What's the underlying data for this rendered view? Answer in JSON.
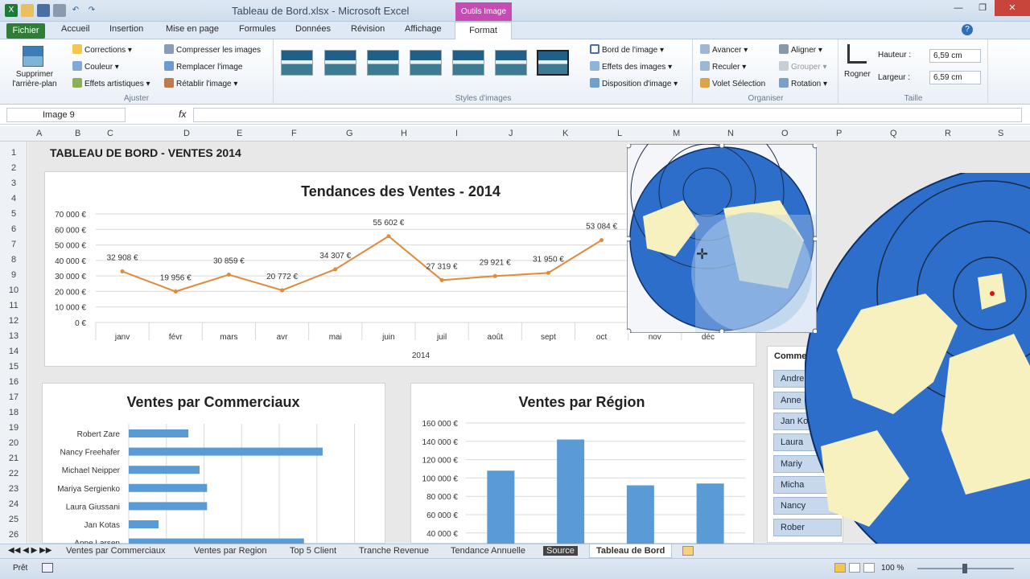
{
  "window": {
    "title": "Tableau de Bord.xlsx - Microsoft Excel",
    "context_tab": "Outils Image"
  },
  "ribbon_tabs": [
    "Fichier",
    "Accueil",
    "Insertion",
    "Mise en page",
    "Formules",
    "Données",
    "Révision",
    "Affichage",
    "Format"
  ],
  "ribbon": {
    "remove_bg": "Supprimer l'arrière-plan",
    "adjust": {
      "label": "Ajuster",
      "corrections": "Corrections",
      "couleur": "Couleur",
      "effets": "Effets artistiques",
      "compresser": "Compresser les images",
      "remplacer": "Remplacer l'image",
      "retablir": "Rétablir l'image"
    },
    "styles": {
      "label": "Styles d'images",
      "bord": "Bord de l'image",
      "effets": "Effets des images",
      "disposition": "Disposition d'image"
    },
    "organiser": {
      "label": "Organiser",
      "avancer": "Avancer",
      "reculer": "Reculer",
      "volet": "Volet Sélection",
      "aligner": "Aligner",
      "grouper": "Grouper",
      "rotation": "Rotation"
    },
    "taille": {
      "label": "Taille",
      "rogner": "Rogner",
      "hauteur_label": "Hauteur :",
      "hauteur": "6,59 cm",
      "largeur_label": "Largeur :",
      "largeur": "6,59 cm"
    }
  },
  "formula_bar": {
    "name_box": "Image 9",
    "fx": "fx",
    "formula": ""
  },
  "columns": [
    "A",
    "B",
    "C",
    "D",
    "E",
    "F",
    "G",
    "H",
    "I",
    "J",
    "K",
    "L",
    "M",
    "N",
    "O",
    "P",
    "Q",
    "R",
    "S"
  ],
  "rows": [
    "1",
    "2",
    "3",
    "4",
    "5",
    "6",
    "7",
    "8",
    "9",
    "10",
    "11",
    "12",
    "13",
    "14",
    "15",
    "16",
    "17",
    "18",
    "19",
    "20",
    "21",
    "22",
    "23",
    "24",
    "25",
    "26"
  ],
  "dashboard_title": "TABLEAU DE BORD - VENTES 2014",
  "chart_data": [
    {
      "type": "line",
      "title": "Tendances des Ventes - 2014",
      "xlabel": "2014",
      "categories": [
        "janv",
        "févr",
        "mars",
        "avr",
        "mai",
        "juin",
        "juil",
        "août",
        "sept",
        "oct",
        "nov",
        "déc"
      ],
      "values": [
        32908,
        19956,
        30859,
        20772,
        34307,
        55602,
        27319,
        29921,
        31950,
        53084,
        null,
        null
      ],
      "labels": [
        "32 908 €",
        "19 956 €",
        "30 859 €",
        "20 772 €",
        "34 307 €",
        "55 602 €",
        "27 319 €",
        "29 921 €",
        "31 950 €",
        "53 084 €"
      ],
      "yticks": [
        "0 €",
        "10 000 €",
        "20 000 €",
        "30 000 €",
        "40 000 €",
        "50 000 €",
        "60 000 €",
        "70 000 €"
      ],
      "ylim": [
        0,
        70000
      ],
      "color": "#e08a3c"
    },
    {
      "type": "bar",
      "title": "Ventes par Commerciaux",
      "categories": [
        "Robert Zare",
        "Nancy Freehafer",
        "Michael Neipper",
        "Mariya Sergienko",
        "Laura Giussani",
        "Jan Kotas",
        "Anne Larsen"
      ],
      "values": [
        16,
        52,
        19,
        21,
        21,
        8,
        47
      ],
      "color": "#5b9bd5"
    },
    {
      "type": "bar",
      "title": "Ventes par Région",
      "yticks": [
        "40 000 €",
        "60 000 €",
        "80 000 €",
        "100 000 €",
        "120 000 €",
        "140 000 €",
        "160 000 €"
      ],
      "values": [
        108000,
        142000,
        92000,
        94000
      ],
      "ylim": [
        40000,
        160000
      ],
      "color": "#5b9bd5"
    }
  ],
  "slicer": {
    "title": "Comme",
    "items": [
      "Andre",
      "Anne",
      "Jan Ko",
      "Laura",
      "Mariy",
      "Micha",
      "Nancy",
      "Rober"
    ]
  },
  "sheet_tabs": [
    "Ventes par Commerciaux",
    "Ventes par Region",
    "Top 5 Client",
    "Tranche Revenue",
    "Tendance Annuelle",
    "Source",
    "Tableau de Bord"
  ],
  "status": {
    "ready": "Prêt",
    "zoom": "100 %"
  }
}
